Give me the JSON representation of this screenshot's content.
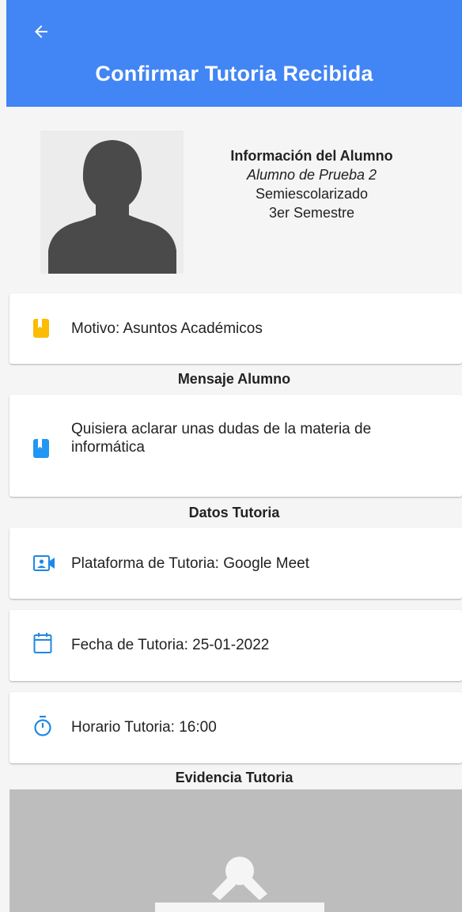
{
  "appbar": {
    "title": "Confirmar Tutoria Recibida",
    "back_icon": "arrow-left-icon",
    "color": "#4285f4"
  },
  "student": {
    "heading": "Información del Alumno",
    "name": "Alumno de Prueba 2",
    "modality": "Semiescolarizado",
    "semester": "3er Semestre",
    "avatar_icon": "person-silhouette-icon"
  },
  "motivo": {
    "text": "Motivo: Asuntos Académicos",
    "icon": "bookmark-icon",
    "icon_color": "#fbbc04"
  },
  "mensaje": {
    "section_title": "Mensaje Alumno",
    "text": "Quisiera aclarar unas dudas de la materia de informática",
    "icon": "bookmark-icon",
    "icon_color": "#2196f3"
  },
  "datos": {
    "section_title": "Datos Tutoria",
    "platform": {
      "text": "Plataforma de Tutoria: Google Meet",
      "icon": "video-contact-icon"
    },
    "date": {
      "text": "Fecha de Tutoria: 25-01-2022",
      "icon": "calendar-icon"
    },
    "time": {
      "text": "Horario Tutoria: 16:00",
      "icon": "timer-icon"
    },
    "icon_color": "#1e88e5"
  },
  "evidencia": {
    "section_title": "Evidencia Tutoria",
    "placeholder_icon": "image-placeholder-icon"
  }
}
